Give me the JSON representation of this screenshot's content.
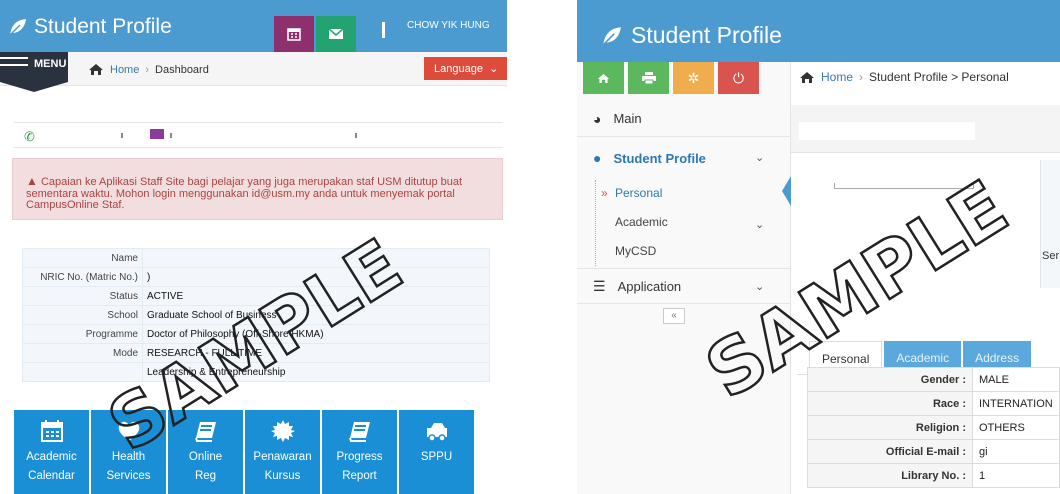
{
  "left": {
    "brand": "Student Profile",
    "user_name": "CHOW YIK HUNG",
    "menu_label": "MENU",
    "breadcrumb": {
      "home": "Home",
      "current": "Dashboard"
    },
    "language_label": "Language",
    "alert_text": "Capaian ke Aplikasi Staff Site bagi pelajar yang juga merupakan staf USM ditutup buat sementara waktu. Mohon login menggunakan id@usm.my anda untuk menyemak portal CampusOnline Staf.",
    "profile_rows": [
      {
        "label": "Name",
        "value": ""
      },
      {
        "label": "NRIC No. (Matric No.)",
        "value": ")"
      },
      {
        "label": "Status",
        "value": "ACTIVE"
      },
      {
        "label": "School",
        "value": "Graduate School of Business"
      },
      {
        "label": "Programme",
        "value": "Doctor of Philosophy (Off-Shore HKMA)"
      },
      {
        "label": "Mode",
        "value": "RESEARCH - FULL TIME"
      },
      {
        "label": "",
        "value": "Leadership & Entrepreneurship"
      }
    ],
    "tiles": [
      {
        "line1": "Academic",
        "line2": "Calendar",
        "icon": "calendar-icon"
      },
      {
        "line1": "Health",
        "line2": "Services",
        "icon": "heart-icon"
      },
      {
        "line1": "Online",
        "line2": "Reg",
        "icon": "book-icon"
      },
      {
        "line1": "Penawaran",
        "line2": "Kursus",
        "icon": "gear-icon"
      },
      {
        "line1": "Progress",
        "line2": "Report",
        "icon": "book-icon"
      },
      {
        "line1": "SPPU",
        "line2": "",
        "icon": "truck-icon"
      }
    ],
    "colors": {
      "header": "#4c9bd0",
      "calendar_btn": "#8e2f6e",
      "mail_btn": "#23a372",
      "language_btn": "#dd4c3b",
      "tile": "#1b8fd6"
    }
  },
  "right": {
    "brand": "Student Profile",
    "breadcrumb": {
      "home": "Home",
      "current": "Student Profile > Personal"
    },
    "nav": {
      "main": "Main",
      "student_profile": "Student Profile",
      "personal": "Personal",
      "academic": "Academic",
      "mycsd": "MyCSD",
      "application": "Application"
    },
    "ser_text": "Ser",
    "tabs": [
      "Personal",
      "Academic",
      "Address"
    ],
    "details": [
      {
        "label": "Gender :",
        "value": "MALE"
      },
      {
        "label": "Race :",
        "value": "INTERNATION"
      },
      {
        "label": "Religion :",
        "value": "OTHERS"
      },
      {
        "label": "Official E-mail :",
        "value": "gi"
      },
      {
        "label": "Library No. :",
        "value": "1"
      }
    ],
    "colors": {
      "home_btn": "#5cb85c",
      "print_btn": "#5cb85c",
      "settings_btn": "#f0ad4e",
      "power_btn": "#d9534f"
    }
  },
  "watermark": "SAMPLE"
}
